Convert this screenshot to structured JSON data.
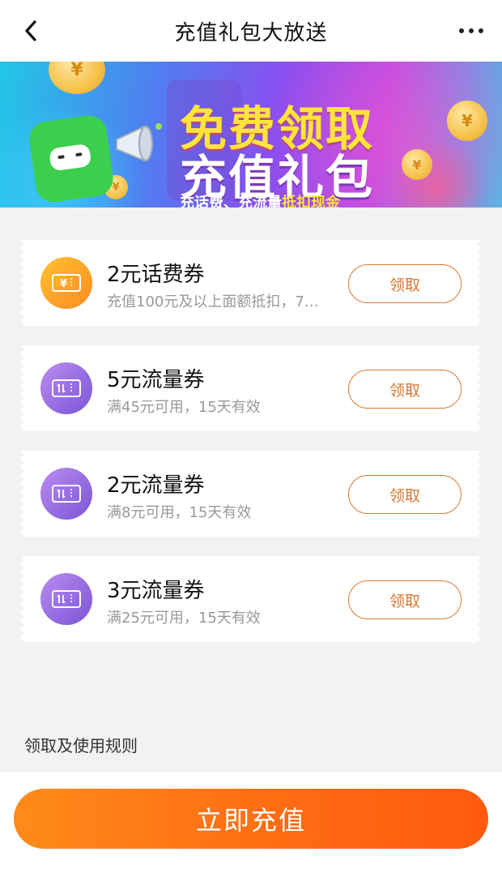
{
  "header": {
    "title": "充值礼包大放送",
    "back_icon": "back-arrow-icon",
    "more_icon": "more-dots-icon"
  },
  "banner": {
    "title_line1": "免费领取",
    "title_line2": "充值礼包",
    "subtitle_prefix": "充话费、充流量",
    "subtitle_highlight": "抵扣现金"
  },
  "coupons": [
    {
      "title": "2元话费券",
      "desc": "充值100元及以上面额抵扣，7…",
      "button": "领取",
      "icon": "phone-bill-ticket-icon",
      "color": "orange"
    },
    {
      "title": "5元流量券",
      "desc": "满45元可用，15天有效",
      "button": "领取",
      "icon": "data-ticket-icon",
      "color": "purple"
    },
    {
      "title": "2元流量券",
      "desc": "满8元可用，15天有效",
      "button": "领取",
      "icon": "data-ticket-icon",
      "color": "purple"
    },
    {
      "title": "3元流量券",
      "desc": "满25元可用，15天有效",
      "button": "领取",
      "icon": "data-ticket-icon",
      "color": "purple"
    }
  ],
  "rules": {
    "title": "领取及使用规则"
  },
  "footer": {
    "button": "立即充值"
  },
  "colors": {
    "accent": "#ff6a12",
    "button_border": "#d9772e"
  }
}
